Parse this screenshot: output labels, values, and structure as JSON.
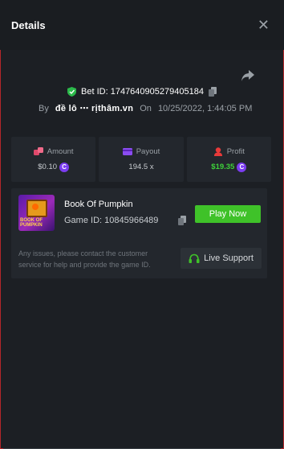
{
  "header": {
    "title": "Details",
    "close_label": "✕"
  },
  "bet": {
    "id_text": "Bet ID: 1747640905279405184",
    "by_label": "By",
    "username": "đề lô ⋯ rịthâm.vn",
    "on_label": "On",
    "datetime": "10/25/2022, 1:44:05 PM"
  },
  "stats": [
    {
      "label": "Amount",
      "value": "$0.10",
      "icon": "dice-icon",
      "coin": "C"
    },
    {
      "label": "Payout",
      "value": "194.5 x",
      "icon": "card-icon"
    },
    {
      "label": "Profit",
      "value": "$19.35",
      "icon": "trophy-icon",
      "coin": "C"
    }
  ],
  "game": {
    "name": "Book Of Pumpkin",
    "id_text": "Game ID: 10845966489",
    "thumb_label": "BOOK OF PUMPKIN",
    "play_label": "Play Now",
    "note": "Any issues, please contact the customer service for help and provide the game ID.",
    "support_label": "Live Support"
  },
  "colors": {
    "accent_green": "#3fc229",
    "profit_green": "#3ed13a",
    "coin_purple": "#7b3cf0",
    "shield_green": "#2bb94a"
  }
}
